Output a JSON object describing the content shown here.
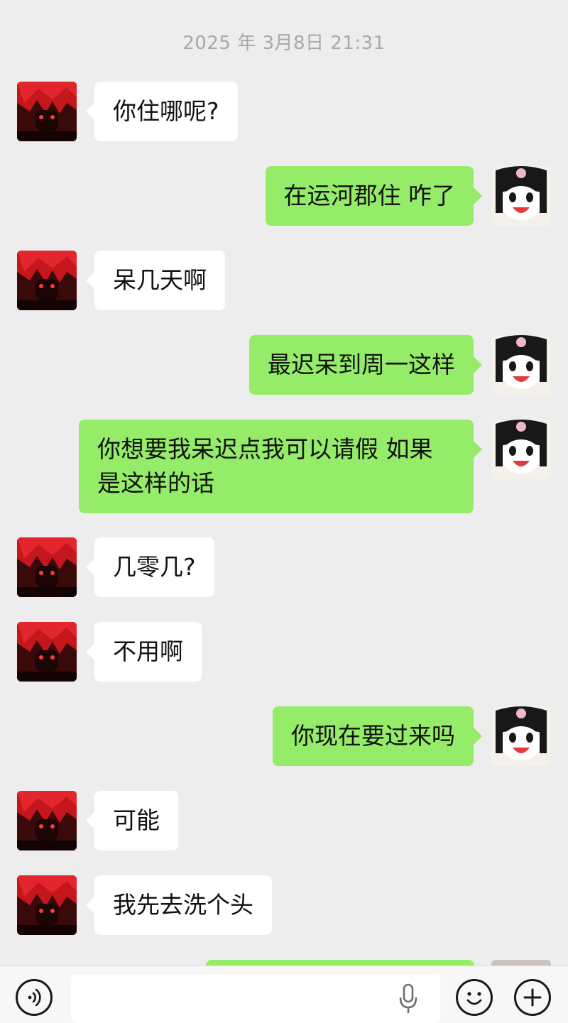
{
  "chat": {
    "timestamp": "2025 年 3月8日 21:31",
    "messages": [
      {
        "side": "left",
        "text": "你住哪呢?"
      },
      {
        "side": "right",
        "text": "在运河郡住 咋了"
      },
      {
        "side": "left",
        "text": "呆几天啊"
      },
      {
        "side": "right",
        "text": "最迟呆到周一这样"
      },
      {
        "side": "right",
        "text": "你想要我呆迟点我可以请假 如果是这样的话"
      },
      {
        "side": "left",
        "text": "几零几?"
      },
      {
        "side": "left",
        "text": "不用啊"
      },
      {
        "side": "right",
        "text": "你现在要过来吗"
      },
      {
        "side": "left",
        "text": "可能"
      },
      {
        "side": "left",
        "text": "我先去洗个头"
      }
    ]
  },
  "input_bar": {
    "icons": [
      "voice-icon",
      "microphone-icon",
      "emoji-icon",
      "plus-icon"
    ],
    "text": ""
  },
  "colors": {
    "background": "#ededed",
    "sent_bubble": "#95ec69",
    "received_bubble": "#ffffff"
  }
}
